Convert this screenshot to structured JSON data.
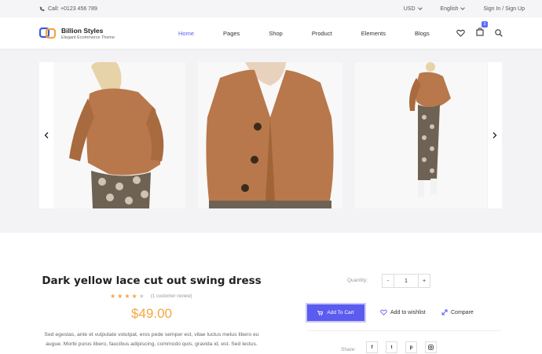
{
  "topbar": {
    "phone": "Call: +0123 456 789",
    "currency": "USD",
    "language": "English",
    "auth": "Sign In / Sign Up"
  },
  "header": {
    "brand_name": "Billion Styles",
    "brand_tagline": "Elegant Ecommerce Theme",
    "nav": [
      "Home",
      "Pages",
      "Shop",
      "Product",
      "Elements",
      "Blogs"
    ],
    "active_nav": "Home",
    "cart_count": "3",
    "accent_color": "#5b5bf0"
  },
  "product": {
    "title": "Dark yellow lace cut out swing dress",
    "rating_stars": 4,
    "rating_max": 5,
    "review_text": "(1 customer review)",
    "price": "$49.00",
    "description": "Sed egestas, ante et vulputate volutpat, eros pede semper est, vitae luctus metus libero eu augue. Morbi purus libero, faucibus adipiscing, commodo quis, gravida id, est. Sed lectus.",
    "quantity_label": "Quantity:",
    "quantity_value": "1",
    "minus": "-",
    "plus": "+",
    "add_to_cart": "Add To Cart",
    "wishlist": "Add to wishlist",
    "compare": "Compare",
    "share_label": "Share:",
    "social": [
      "facebook-icon",
      "twitter-icon",
      "pinterest-icon",
      "instagram-icon"
    ]
  },
  "colors": {
    "price": "#f4a640",
    "sweater": "#b8784b"
  }
}
